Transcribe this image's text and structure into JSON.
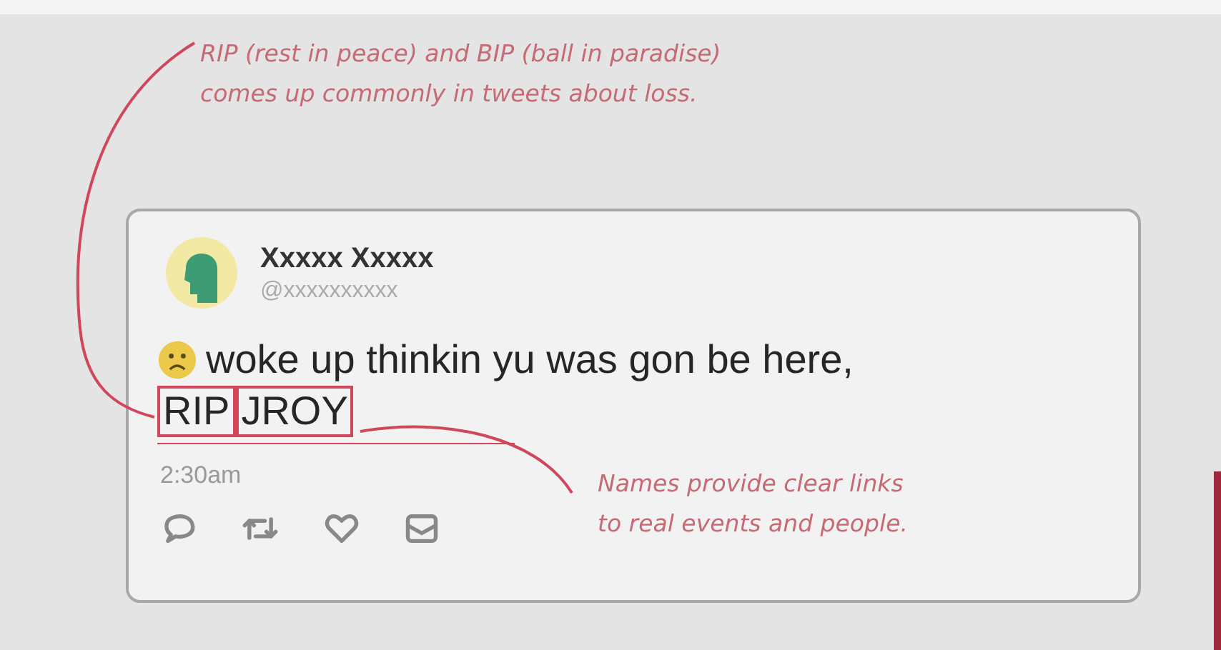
{
  "annotations": [
    {
      "text": "RIP (rest in peace) and BIP (ball in paradise)\ncomes up commonly in tweets about loss."
    },
    {
      "text": "Names provide clear links\nto real events and people."
    }
  ],
  "tweet": {
    "name": "Xxxxx Xxxxx",
    "handle": "@xxxxxxxxxx",
    "text": "woke up thinkin yu was gon be here,",
    "highlighted_words": [
      "RIP",
      "JROY"
    ],
    "time": "2:30am"
  }
}
